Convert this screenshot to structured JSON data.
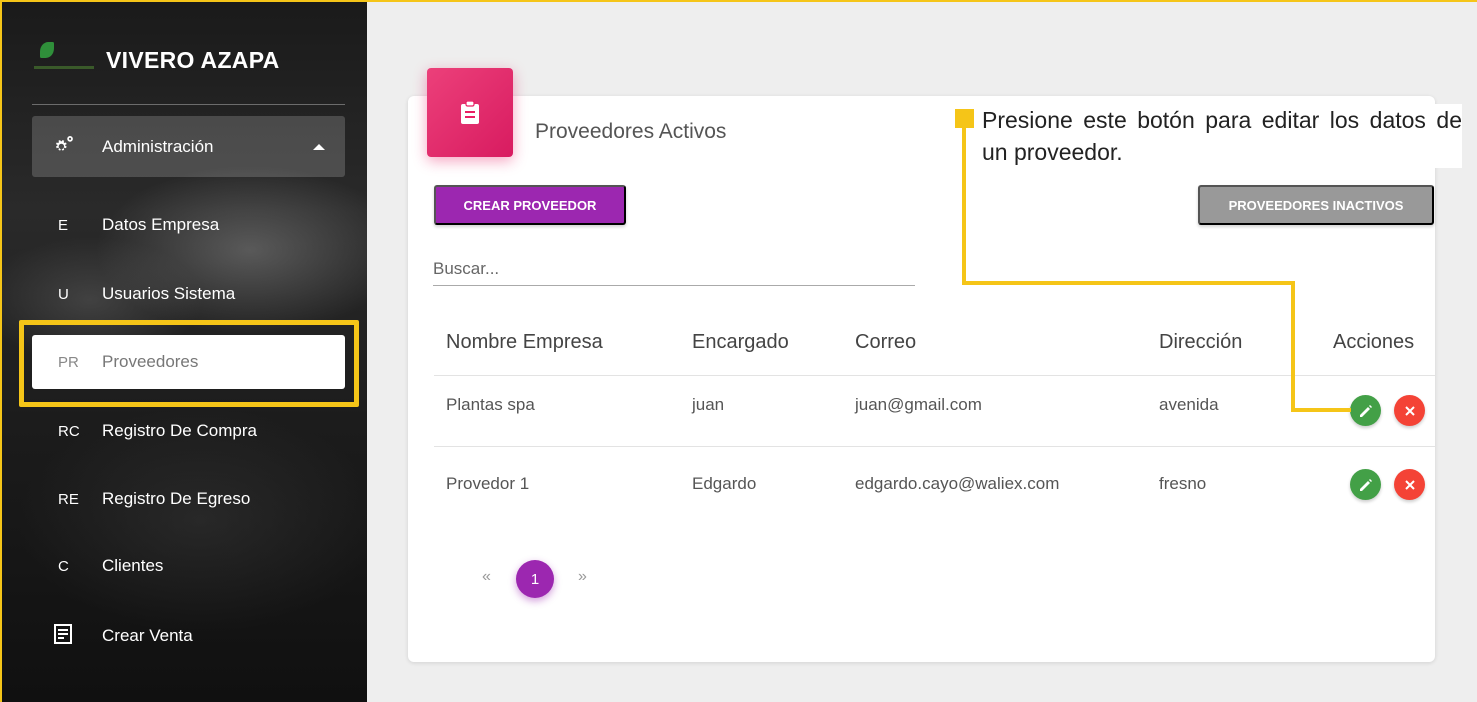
{
  "sidebar": {
    "brand": "VIVERO AZAPA",
    "group": {
      "label": "Administración",
      "icon": "gears-icon"
    },
    "items": [
      {
        "abbr": "E",
        "label": "Datos Empresa"
      },
      {
        "abbr": "U",
        "label": "Usuarios Sistema"
      },
      {
        "abbr": "PR",
        "label": "Proveedores",
        "active": true
      },
      {
        "abbr": "RC",
        "label": "Registro De Compra"
      },
      {
        "abbr": "RE",
        "label": "Registro De Egreso"
      },
      {
        "abbr": "C",
        "label": "Clientes"
      },
      {
        "icon": "receipt-icon",
        "label": "Crear Venta"
      }
    ]
  },
  "card": {
    "icon": "clipboard-icon",
    "title": "Proveedores Activos",
    "create_button": "CREAR PROVEEDOR",
    "inactive_button": "PROVEEDORES INACTIVOS",
    "search_placeholder": "Buscar..."
  },
  "table": {
    "headers": [
      "Nombre Empresa",
      "Encargado",
      "Correo",
      "Dirección",
      "Acciones"
    ],
    "rows": [
      [
        "Plantas spa",
        "juan",
        "juan@gmail.com",
        "avenida"
      ],
      [
        "Provedor 1",
        "Edgardo",
        "edgardo.cayo@waliex.com",
        "fresno"
      ]
    ]
  },
  "pagination": {
    "prev": "«",
    "current": "1",
    "next": "»"
  },
  "annotation": {
    "text": "Presione este botón para editar los datos de un proveedor."
  },
  "colors": {
    "primary": "#9c27b0",
    "accent": "#e91e63",
    "edit": "#43a047",
    "delete": "#f44336",
    "highlight": "#f5c518"
  }
}
